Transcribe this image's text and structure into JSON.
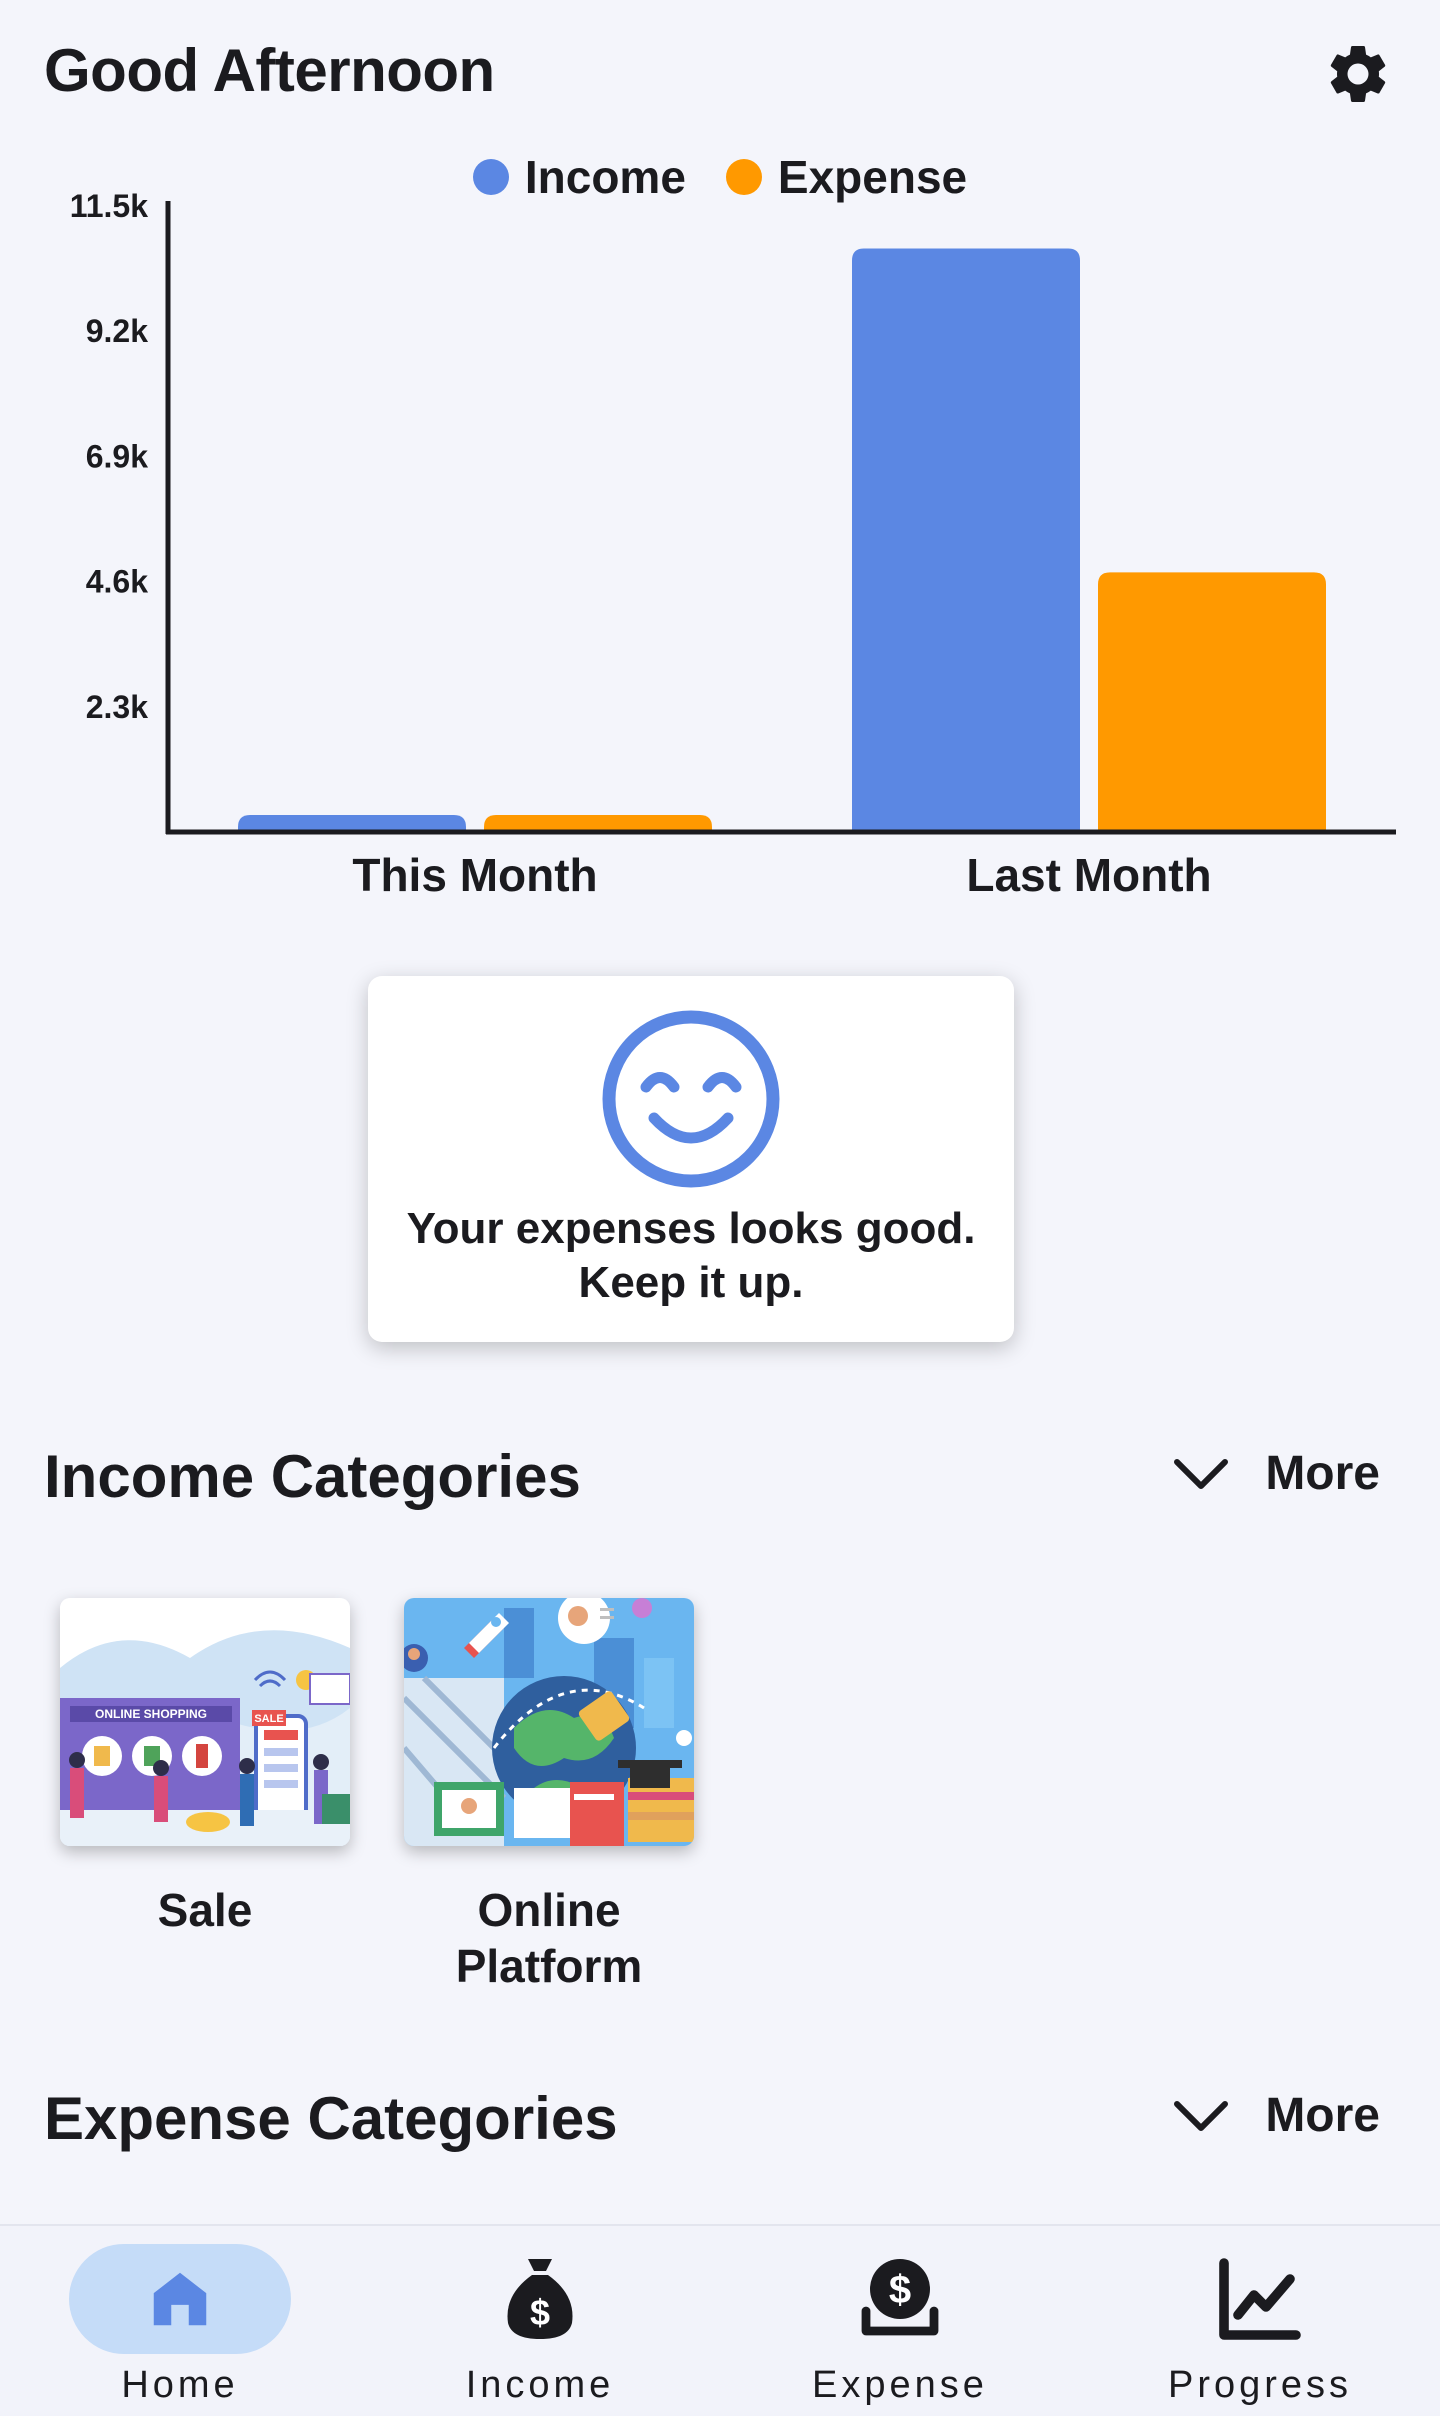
{
  "header": {
    "title": "Good Afternoon",
    "settings_icon": "gear-icon"
  },
  "chart_data": {
    "type": "bar",
    "categories": [
      "This Month",
      "Last Month"
    ],
    "series": [
      {
        "name": "Income",
        "values": [
          150,
          10700
        ],
        "color": "#5b87e3"
      },
      {
        "name": "Expense",
        "values": [
          150,
          4750
        ],
        "color": "#ff9900"
      }
    ],
    "yticks": [
      "2.3k",
      "4.6k",
      "6.9k",
      "9.2k",
      "11.5k"
    ],
    "ytick_values": [
      2300,
      4600,
      6900,
      9200,
      11500
    ],
    "ylim": [
      0,
      11500
    ],
    "legend_position": "top-center",
    "grid": false
  },
  "feedback": {
    "icon": "smiley-icon",
    "line1": "Your expenses looks good.",
    "line2": "Keep it up.",
    "accent": "#5b87e3"
  },
  "income_categories": {
    "title": "Income Categories",
    "more_label": "More",
    "items": [
      {
        "label": "Sale",
        "illustration": "online-shopping-illustration",
        "banner_text": "ONLINE SHOPPING",
        "tag": "SALE"
      },
      {
        "label_line1": "Online",
        "label_line2": "Platform",
        "illustration": "online-platform-illustration"
      }
    ]
  },
  "expense_categories": {
    "title": "Expense Categories",
    "more_label": "More"
  },
  "bottom_nav": {
    "items": [
      {
        "label": "Home",
        "icon": "home-icon",
        "active": true
      },
      {
        "label": "Income",
        "icon": "money-bag-icon",
        "active": false
      },
      {
        "label": "Expense",
        "icon": "expense-coin-icon",
        "active": false
      },
      {
        "label": "Progress",
        "icon": "trend-chart-icon",
        "active": false
      }
    ]
  }
}
